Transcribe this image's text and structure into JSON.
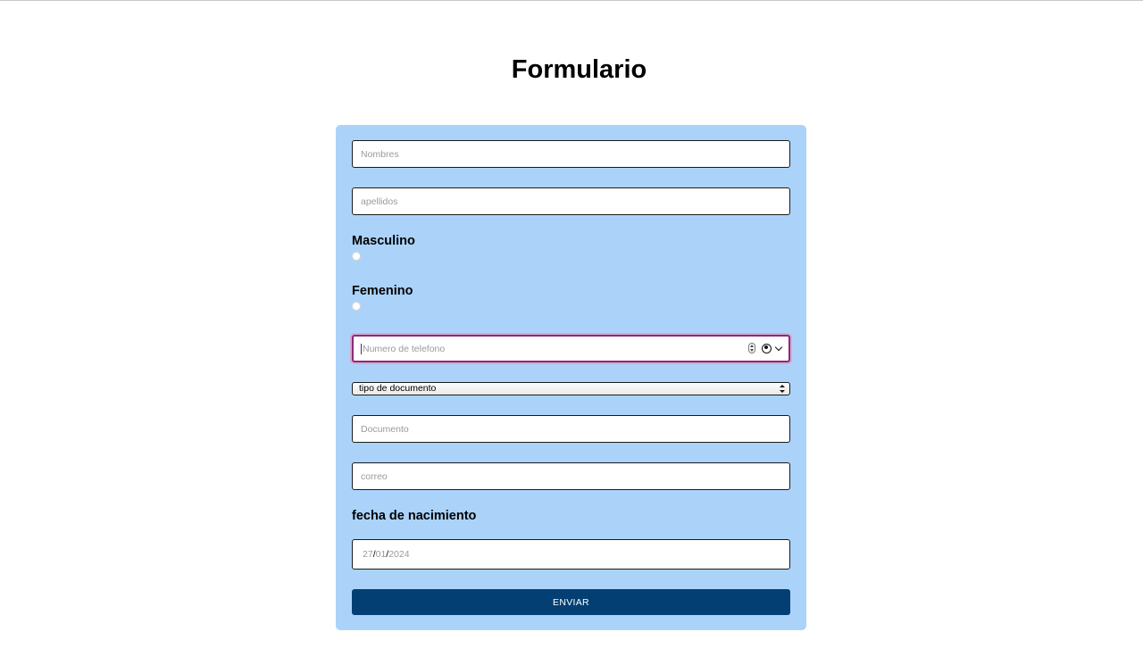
{
  "page": {
    "title": "Formulario"
  },
  "form": {
    "nombres_placeholder": "Nombres",
    "apellidos_placeholder": "apellidos",
    "gender_options": [
      {
        "label": "Masculino",
        "selected": false
      },
      {
        "label": "Femenino",
        "selected": false
      }
    ],
    "telefono_placeholder": "Numero de telefono",
    "tipo_documento": {
      "selected": "tipo de documento"
    },
    "documento_placeholder": "Documento",
    "correo_placeholder": "correo",
    "fecha_label": "fecha de nacimiento",
    "fecha": {
      "day": "27",
      "month": "01",
      "year": "2024",
      "separator": "/"
    },
    "submit_label": "ENVIAR"
  },
  "colors": {
    "card_background": "#abd3fa",
    "submit_background": "#043f73",
    "focus_ring": "#8b2a7a"
  }
}
